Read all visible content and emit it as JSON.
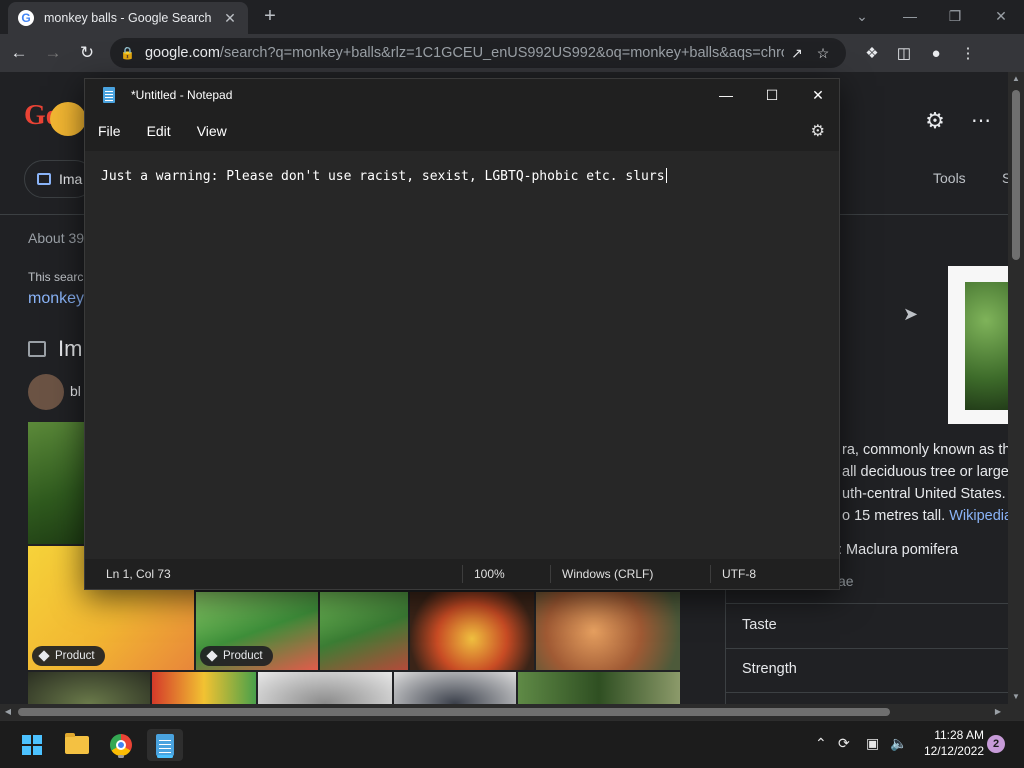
{
  "browser": {
    "tab": {
      "title": "monkey balls - Google Search",
      "favicon": "google-g-icon",
      "favicon_letter": "G",
      "close": "✕"
    },
    "new_tab": "+",
    "window_controls": {
      "dropdown": "⌄",
      "minimize": "—",
      "restore": "❐",
      "close": "✕"
    },
    "omnibox": {
      "host": "google.com",
      "path": "/search?q=monkey+balls&rlz=1C1GCEU_enUS992US992&oq=monkey+balls&aqs=chrome.0.0i..."
    }
  },
  "google": {
    "logo": "Go",
    "images_chip": "Ima",
    "tools": "Tools",
    "tools_overflow": "S",
    "about": "About 39",
    "this_search": "This searc",
    "monkey_link": "monkey",
    "images_heading": "Im",
    "chip_label": "bl",
    "product_badge": "Product",
    "knowledge_panel": {
      "lines": [
        "ra, commonly known as the",
        "all deciduous tree or large s",
        "uth-central United States. It",
        "o 15 metres tall."
      ],
      "wikipedia_link": "Wikipedia",
      "scientific_name": ": Maclura pomifera",
      "family_fragment": "ae",
      "rows": [
        "Taste",
        "Strength"
      ]
    }
  },
  "notepad": {
    "title": "*Untitled - Notepad",
    "menu": [
      "File",
      "Edit",
      "View"
    ],
    "content": "Just a warning: Please don't use racist, sexist, LGBTQ-phobic etc. slurs",
    "status": {
      "position": "Ln 1, Col 73",
      "zoom": "100%",
      "line_ending": "Windows (CRLF)",
      "encoding": "UTF-8"
    }
  },
  "taskbar": {
    "clock_time": "11:28 AM",
    "clock_date": "12/12/2022",
    "notification_count": "2"
  },
  "colors": {
    "google_link": "#8ab4f8",
    "windows_accent": "#4cc2ff",
    "notepad_bg": "#272727"
  }
}
